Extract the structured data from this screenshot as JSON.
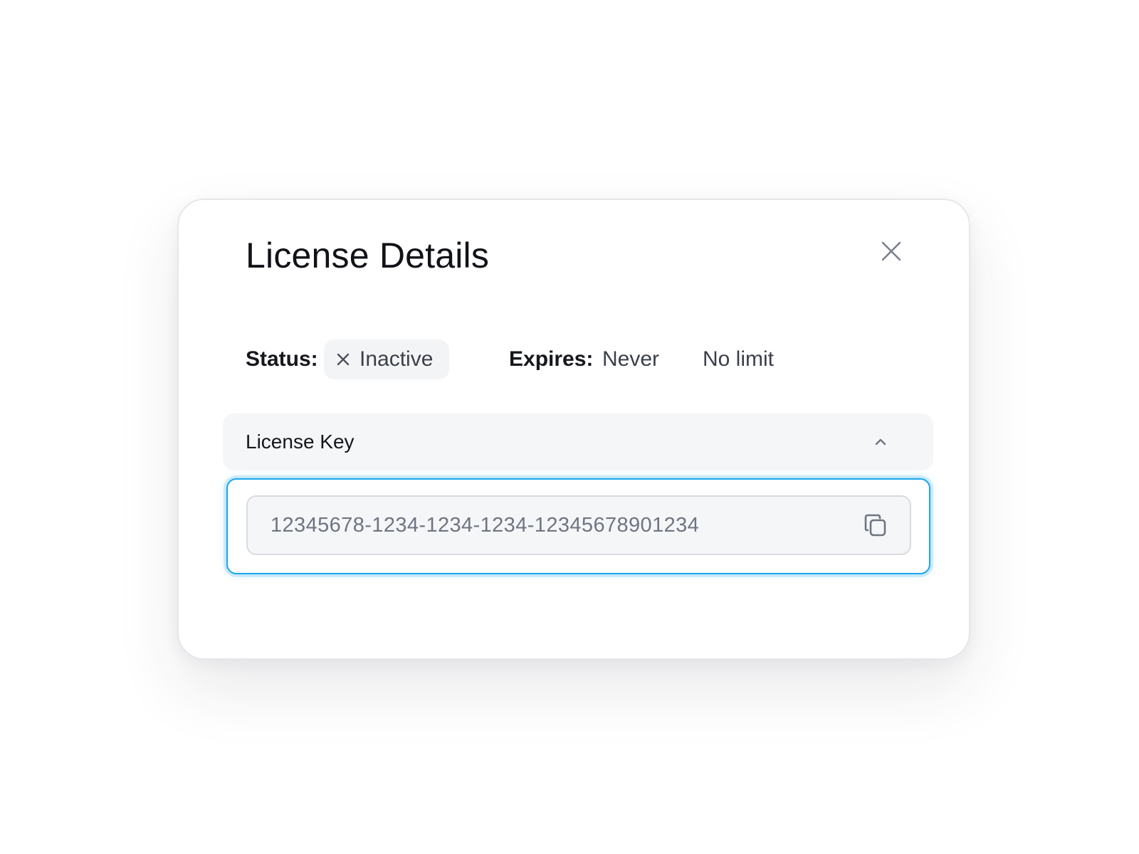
{
  "dialog": {
    "title": "License Details",
    "close_icon": "close-icon"
  },
  "meta": {
    "status_label": "Status:",
    "status_value": "Inactive",
    "status_icon": "x-icon",
    "expires_label": "Expires:",
    "expires_value": "Never",
    "limit_value": "No limit"
  },
  "license_key": {
    "section_title": "License Key",
    "expanded_icon": "chevron-up-icon",
    "value": "12345678-1234-1234-1234-12345678901234",
    "copy_icon": "copy-icon"
  },
  "colors": {
    "focus_ring": "#1ba6ea",
    "panel_bg": "#f5f6f8",
    "muted_text": "#6f7482"
  }
}
